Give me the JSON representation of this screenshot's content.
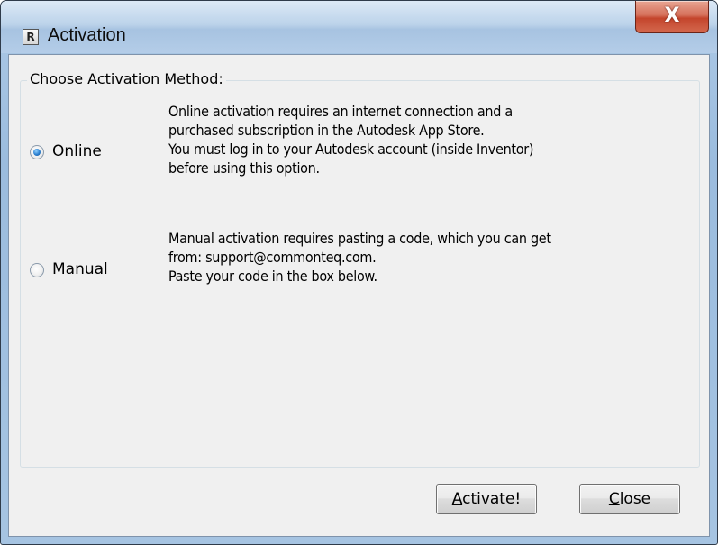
{
  "window": {
    "title": "Activation",
    "app_icon_letter": "R",
    "close_glyph": "X"
  },
  "group": {
    "legend": "Choose Activation Method:"
  },
  "options": [
    {
      "label": "Online",
      "checked": true,
      "description": [
        "Online activation requires an internet connection and a",
        "purchased subscription in the Autodesk App Store.",
        "You must log in to your Autodesk account (inside Inventor)",
        "before using this option."
      ]
    },
    {
      "label": "Manual",
      "checked": false,
      "description": [
        "Manual activation requires pasting a code, which you can get",
        "from: support@commonteq.com.",
        "Paste your code in the box below."
      ]
    }
  ],
  "buttons": {
    "activate": {
      "mnemonic": "A",
      "rest": "ctivate!"
    },
    "close": {
      "mnemonic": "C",
      "rest": "lose"
    }
  }
}
